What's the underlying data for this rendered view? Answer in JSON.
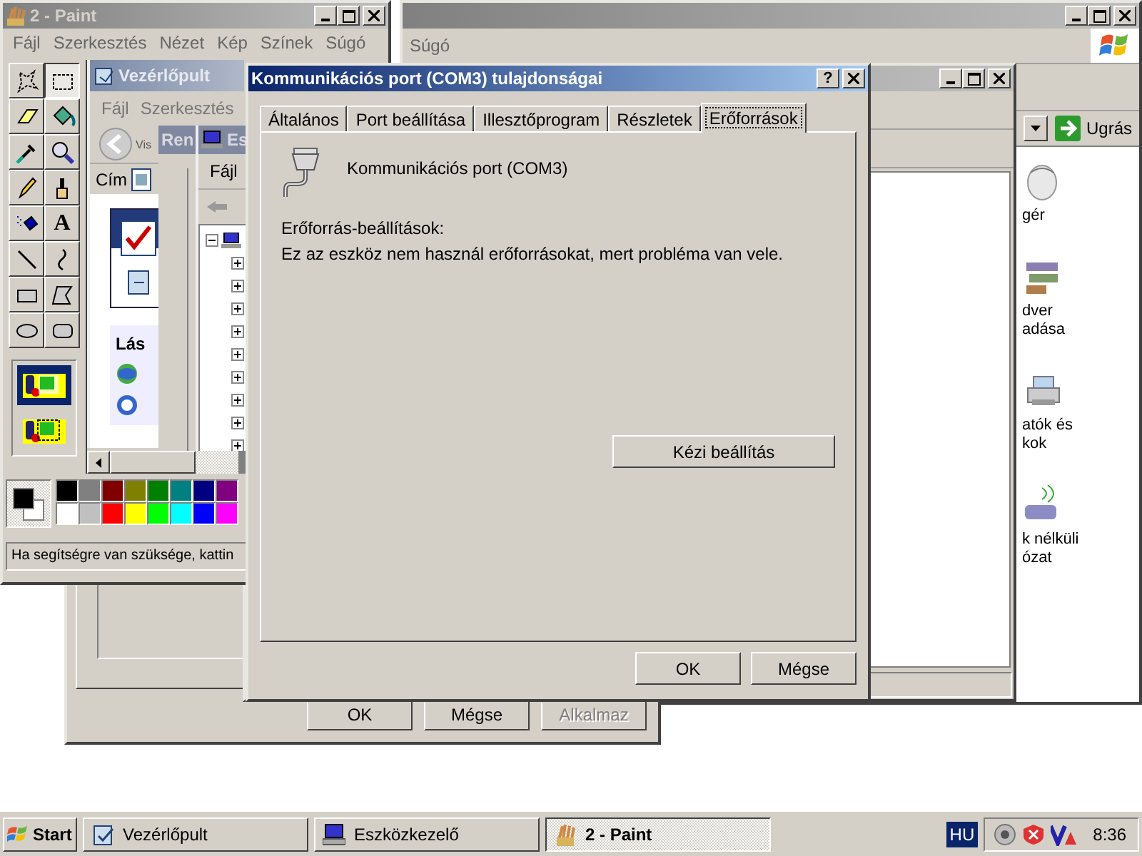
{
  "control_panel_window": {
    "menu_items": [
      "Súgó"
    ],
    "go_button": "Ugrás",
    "icon_labels": [
      {
        "lines": [
          "gér"
        ]
      },
      {
        "lines": [
          "dver",
          "adása"
        ]
      },
      {
        "lines": [
          "atók és",
          "kok"
        ]
      },
      {
        "lines": [
          "k nélküli",
          "ózat"
        ]
      }
    ]
  },
  "system_properties_dialog": {
    "buttons": [
      {
        "label": "OK",
        "disabled": false
      },
      {
        "label": "Mégse",
        "disabled": false
      },
      {
        "label": "Alkalmaz",
        "disabled": true
      }
    ]
  },
  "paint_window": {
    "title": "2 - Paint",
    "menu_items": [
      "Fájl",
      "Szerkesztés",
      "Nézet",
      "Kép",
      "Színek",
      "Súgó"
    ],
    "tools": [
      {
        "kind": "free-select",
        "selected": false
      },
      {
        "kind": "rect-select",
        "selected": true
      },
      {
        "kind": "eraser",
        "selected": false
      },
      {
        "kind": "fill",
        "selected": false
      },
      {
        "kind": "picker",
        "selected": false
      },
      {
        "kind": "magnifier",
        "selected": false
      },
      {
        "kind": "pencil",
        "selected": false
      },
      {
        "kind": "brush",
        "selected": false
      },
      {
        "kind": "airbrush",
        "selected": false
      },
      {
        "kind": "text",
        "selected": false,
        "glyph": "A"
      },
      {
        "kind": "line",
        "selected": false
      },
      {
        "kind": "curve",
        "selected": false
      },
      {
        "kind": "rectangle",
        "selected": false
      },
      {
        "kind": "polygon",
        "selected": false
      },
      {
        "kind": "ellipse",
        "selected": false
      },
      {
        "kind": "rounded-rectangle",
        "selected": false
      }
    ],
    "transparency_options": [
      {
        "selected": true
      },
      {
        "selected": false
      }
    ],
    "canvas_picture": {
      "window_title": "Vezérlőpult",
      "menu_items": [
        "Fájl",
        "Szerkesztés"
      ],
      "back_label": "Vis",
      "address_label": "Cím",
      "section_label": "Lás",
      "dialog_title": "Ren",
      "manager_title": "Es",
      "manager_menu": "Fájl",
      "tree": {
        "expanded": true,
        "children": [
          {
            "expanded": false
          },
          {
            "expanded": false
          },
          {
            "expanded": false
          },
          {
            "expanded": false
          },
          {
            "expanded": false
          },
          {
            "expanded": false
          },
          {
            "expanded": false
          },
          {
            "expanded": false
          },
          {
            "expanded": false
          }
        ]
      }
    },
    "palette": {
      "colors": [
        {
          "color": "#000000"
        },
        {
          "color": "#808080"
        },
        {
          "color": "#800000"
        },
        {
          "color": "#808000"
        },
        {
          "color": "#008000"
        },
        {
          "color": "#008080"
        },
        {
          "color": "#000080"
        },
        {
          "color": "#800080"
        },
        {
          "color": "#ffffff"
        },
        {
          "color": "#c0c0c0"
        },
        {
          "color": "#ff0000"
        },
        {
          "color": "#ffff00"
        },
        {
          "color": "#00ff00"
        },
        {
          "color": "#00ffff"
        },
        {
          "color": "#0000ff"
        },
        {
          "color": "#ff00ff"
        }
      ]
    },
    "status_text": "Ha segítségre van szüksége, kattin"
  },
  "properties_dialog": {
    "title": "Kommunikációs port (COM3) tulajdonságai",
    "help_button": "?",
    "tabs": [
      {
        "label": "Általános",
        "selected": false
      },
      {
        "label": "Port beállítása",
        "selected": false
      },
      {
        "label": "Illesztőprogram",
        "selected": false
      },
      {
        "label": "Részletek",
        "selected": false
      },
      {
        "label": "Erőforrások",
        "selected": true
      }
    ],
    "device_name": "Kommunikációs port (COM3)",
    "resource_settings_label": "Erőforrás-beállítások:",
    "message": "Ez az eszköz nem használ erőforrásokat, mert probléma van vele.",
    "manual_button": "Kézi beállítás",
    "buttons": [
      "OK",
      "Mégse"
    ]
  },
  "taskbar": {
    "start": "Start",
    "tasks": [
      {
        "kind": "control-panel",
        "label": "Vezérlőpult",
        "selected": false
      },
      {
        "kind": "device-manager",
        "label": "Eszközkezelő",
        "selected": false
      },
      {
        "kind": "paint",
        "label": "2 - Paint",
        "selected": true
      }
    ],
    "language": "HU",
    "clock": "8:36"
  }
}
